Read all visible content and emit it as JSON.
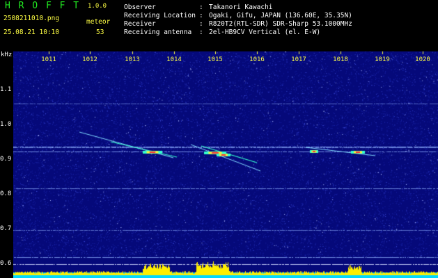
{
  "header": {
    "brand": "H R O F F T",
    "version": "1.0.0",
    "filename": "2508211010.png",
    "datetime": "25.08.21 10:10",
    "meteor_label": "meteor",
    "meteor_count": "53"
  },
  "info": [
    {
      "key": "Observer",
      "value": "Takanori Kawachi"
    },
    {
      "key": "Receiving Location",
      "value": "Ogaki, Gifu, JAPAN (136.60E, 35.35N)"
    },
    {
      "key": "Receiver",
      "value": "R820T2(RTL-SDR) SDR-Sharp 53.1000MHz"
    },
    {
      "key": "Receiving antenna",
      "value": "2el-HB9CV Vertical (el. E-W)"
    }
  ],
  "plot": {
    "y_unit": "kHz",
    "y_ticks": [
      "1.1",
      "1.0",
      "0.9",
      "0.8",
      "0.7",
      "0.6"
    ],
    "x_ticks": [
      "1011",
      "1012",
      "1013",
      "1014",
      "1015",
      "1016",
      "1017",
      "1018",
      "1019",
      "1020"
    ],
    "colors": {
      "background": "#05097a",
      "noise": "#3a4ad8",
      "carrier": "#8fb0ff",
      "meteor_hot": "#ff3030",
      "meteor_mid": "#ffee33",
      "meteor_cool": "#33ffcc",
      "bottom_cyan": "#00d8ff",
      "bottom_yellow": "#ffee00"
    }
  }
}
